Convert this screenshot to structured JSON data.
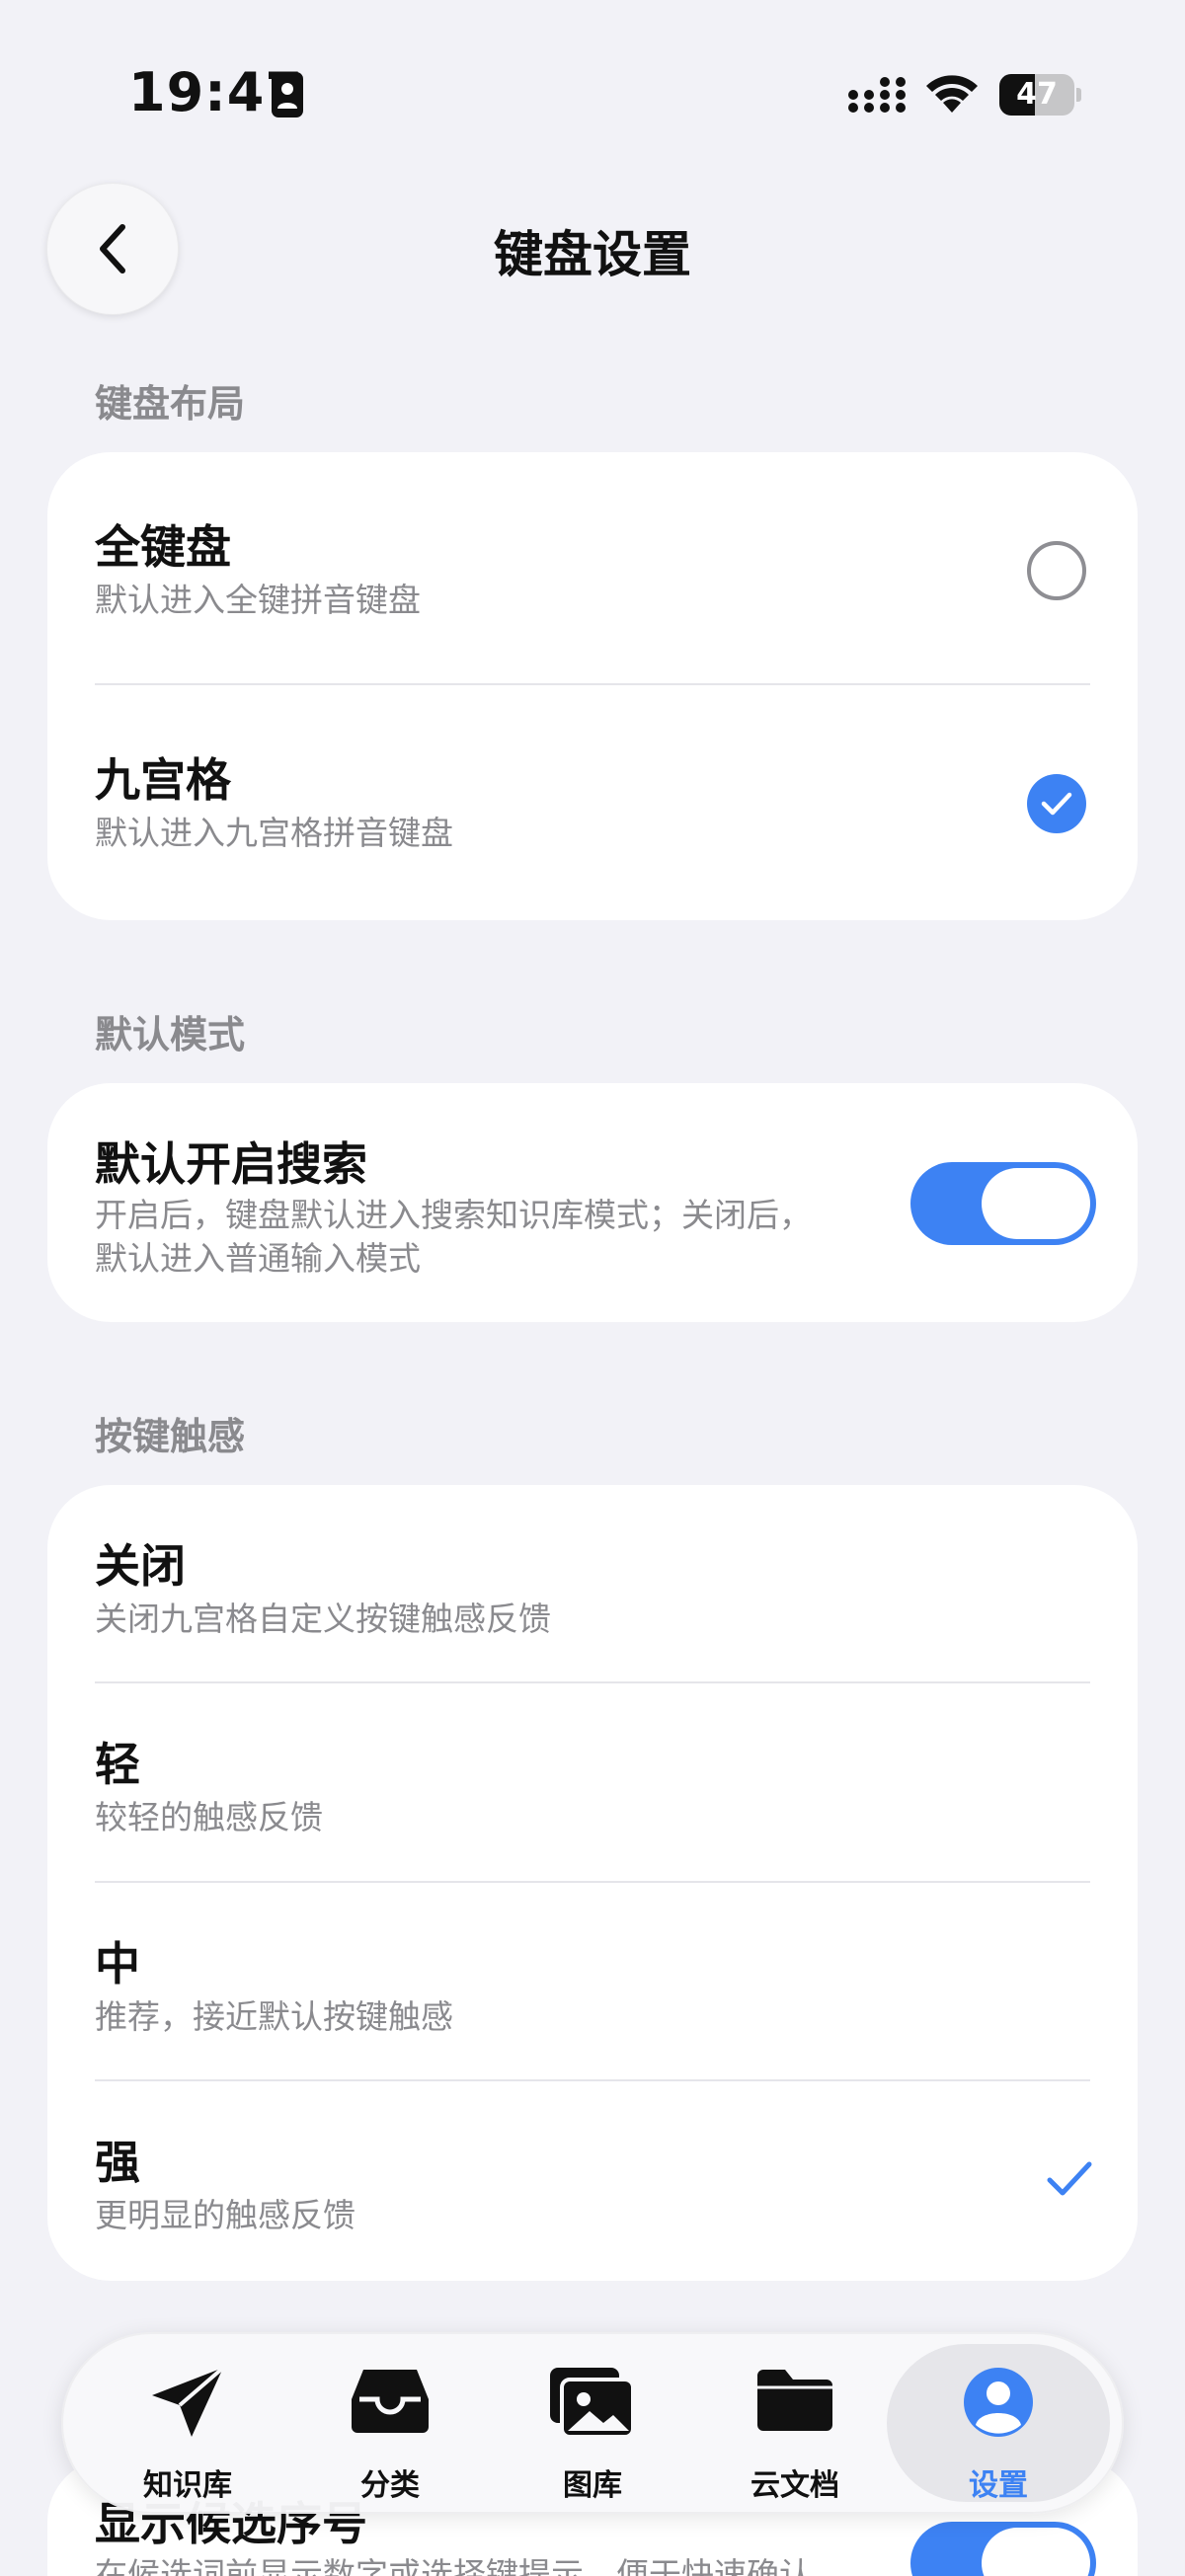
{
  "status_bar": {
    "time": "19:47",
    "battery_level": "47",
    "battery_percent": 47
  },
  "header": {
    "title": "键盘设置",
    "back_icon": "chevron-left-icon"
  },
  "sections": {
    "layout": {
      "label": "键盘布局",
      "items": [
        {
          "title": "全键盘",
          "subtitle": "默认进入全键拼音键盘",
          "selected": false
        },
        {
          "title": "九宫格",
          "subtitle": "默认进入九宫格拼音键盘",
          "selected": true
        }
      ]
    },
    "default_mode": {
      "label": "默认模式",
      "item": {
        "title": "默认开启搜索",
        "subtitle_line1": "开启后，键盘默认进入搜索知识库模式；关闭后，",
        "subtitle_line2": "默认进入普通输入模式",
        "enabled": true
      }
    },
    "haptics": {
      "label": "按键触感",
      "items": [
        {
          "title": "关闭",
          "subtitle": "关闭九宫格自定义按键触感反馈",
          "selected": false
        },
        {
          "title": "轻",
          "subtitle": "较轻的触感反馈",
          "selected": false
        },
        {
          "title": "中",
          "subtitle": "推荐，接近默认按键触感",
          "selected": false
        },
        {
          "title": "强",
          "subtitle": "更明显的触感反馈",
          "selected": true
        }
      ]
    },
    "candidate_index": {
      "title": "显示候选序号",
      "subtitle": "在候选词前显示数字或选择键提示，便于快速确认",
      "enabled": true
    }
  },
  "tab_bar": {
    "tabs": [
      {
        "label": "知识库",
        "icon": "send-icon"
      },
      {
        "label": "分类",
        "icon": "inbox-icon"
      },
      {
        "label": "图库",
        "icon": "photos-icon"
      },
      {
        "label": "云文档",
        "icon": "folder-icon"
      },
      {
        "label": "设置",
        "icon": "person-icon",
        "active": true
      }
    ]
  },
  "colors": {
    "accent": "#3d82f3",
    "background": "#f2f2f7",
    "card": "#ffffff",
    "secondary_text": "#8a8a8e"
  }
}
